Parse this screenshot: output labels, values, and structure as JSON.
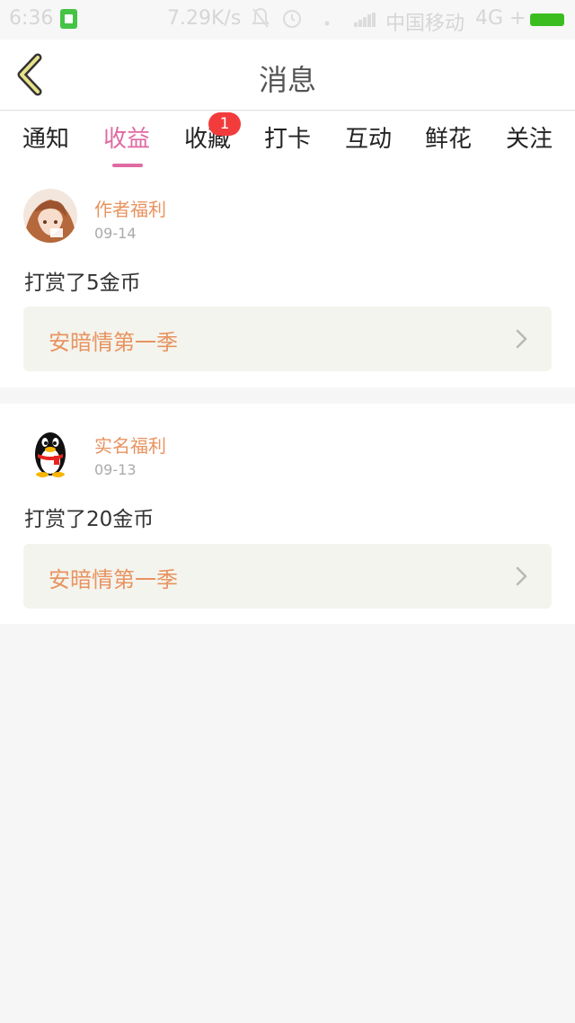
{
  "status_bar": {
    "time": "6:36",
    "speed": "7.29K/s",
    "carrier": "中国移动",
    "network": "4G +",
    "icons": [
      "sim-icon",
      "bell-off-icon",
      "alarm-icon",
      "wifi-icon",
      "signal-icon",
      "battery-icon"
    ]
  },
  "header": {
    "title": "消息",
    "back_icon": "chevron-left-icon"
  },
  "tabs": [
    {
      "label": "通知"
    },
    {
      "label": "收益",
      "active": true
    },
    {
      "label": "收藏",
      "badge": "1"
    },
    {
      "label": "打卡"
    },
    {
      "label": "互动"
    },
    {
      "label": "鲜花"
    },
    {
      "label": "关注"
    }
  ],
  "messages": [
    {
      "author": "作者福利",
      "date": "09-14",
      "content": "打赏了5金币",
      "book": "安暗情第一季",
      "avatar": "anime-girl-avatar"
    },
    {
      "author": "实名福利",
      "date": "09-13",
      "content": "打赏了20金币",
      "book": "安暗情第一季",
      "avatar": "qq-penguin-avatar"
    }
  ],
  "colors": {
    "accent": "#e06aa2",
    "author": "#e8935f",
    "badge": "#f23c3c",
    "battery": "#3bbd1f",
    "back_icon": "#7a7a1a"
  }
}
